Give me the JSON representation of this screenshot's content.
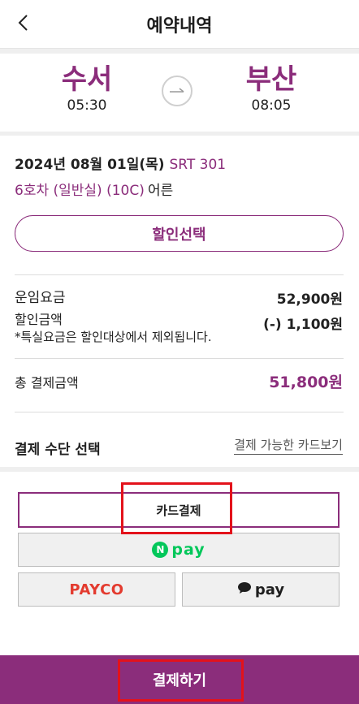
{
  "header": {
    "title": "예약내역",
    "back_icon": "chevron-left-icon"
  },
  "route": {
    "departure": {
      "station": "수서",
      "time": "05:30"
    },
    "arrival": {
      "station": "부산",
      "time": "08:05"
    },
    "arrow_icon": "arrow-right-icon"
  },
  "trip": {
    "date": "2024년 08월 01일(목)",
    "train": "SRT 301",
    "seat": "6호차 (일반실) (10C)",
    "passenger": "어른"
  },
  "discount_button": "할인선택",
  "fare": {
    "base_label": "운임요금",
    "base_value": "52,900원",
    "discount_label": "할인금액",
    "discount_value": "(-) 1,100원",
    "note": "*특실요금은 할인대상에서 제외됩니다.",
    "total_label": "총 결제금액",
    "total_value": "51,800원"
  },
  "payment": {
    "title": "결제 수단 선택",
    "card_link": "결제 가능한 카드보기",
    "options": {
      "card": "카드결제",
      "npay_badge": "N",
      "npay": "pay",
      "payco": "PAYCO",
      "kakao": "pay"
    }
  },
  "pay_button": "결제하기",
  "colors": {
    "brand": "#8b2d7b",
    "npay": "#03c75a",
    "payco": "#e33b2f",
    "highlight": "#e3121b"
  }
}
